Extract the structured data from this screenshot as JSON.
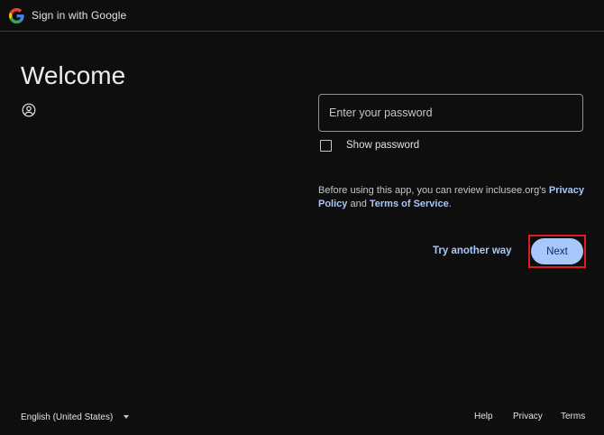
{
  "header": {
    "title": "Sign in with Google",
    "logo_icon": "google-g-logo"
  },
  "main": {
    "heading": "Welcome",
    "account_icon": "account-circle-icon"
  },
  "form": {
    "password_placeholder": "Enter your password",
    "password_value": "",
    "show_password_label": "Show password",
    "show_password_checked": false
  },
  "terms": {
    "prefix": "Before using this app, you can review inclusee.org's ",
    "privacy_link": "Privacy Policy",
    "middle": " and ",
    "terms_link": "Terms of Service",
    "suffix": "."
  },
  "actions": {
    "try_another_label": "Try another way",
    "next_label": "Next"
  },
  "footer": {
    "language": "English (United States)",
    "help": "Help",
    "privacy": "Privacy",
    "terms": "Terms"
  },
  "colors": {
    "background": "#0e0e0e",
    "link": "#a8c7fa",
    "primary_button": "#a8c7fa",
    "primary_button_text": "#062e6f",
    "highlight_outline": "#e01b24"
  }
}
